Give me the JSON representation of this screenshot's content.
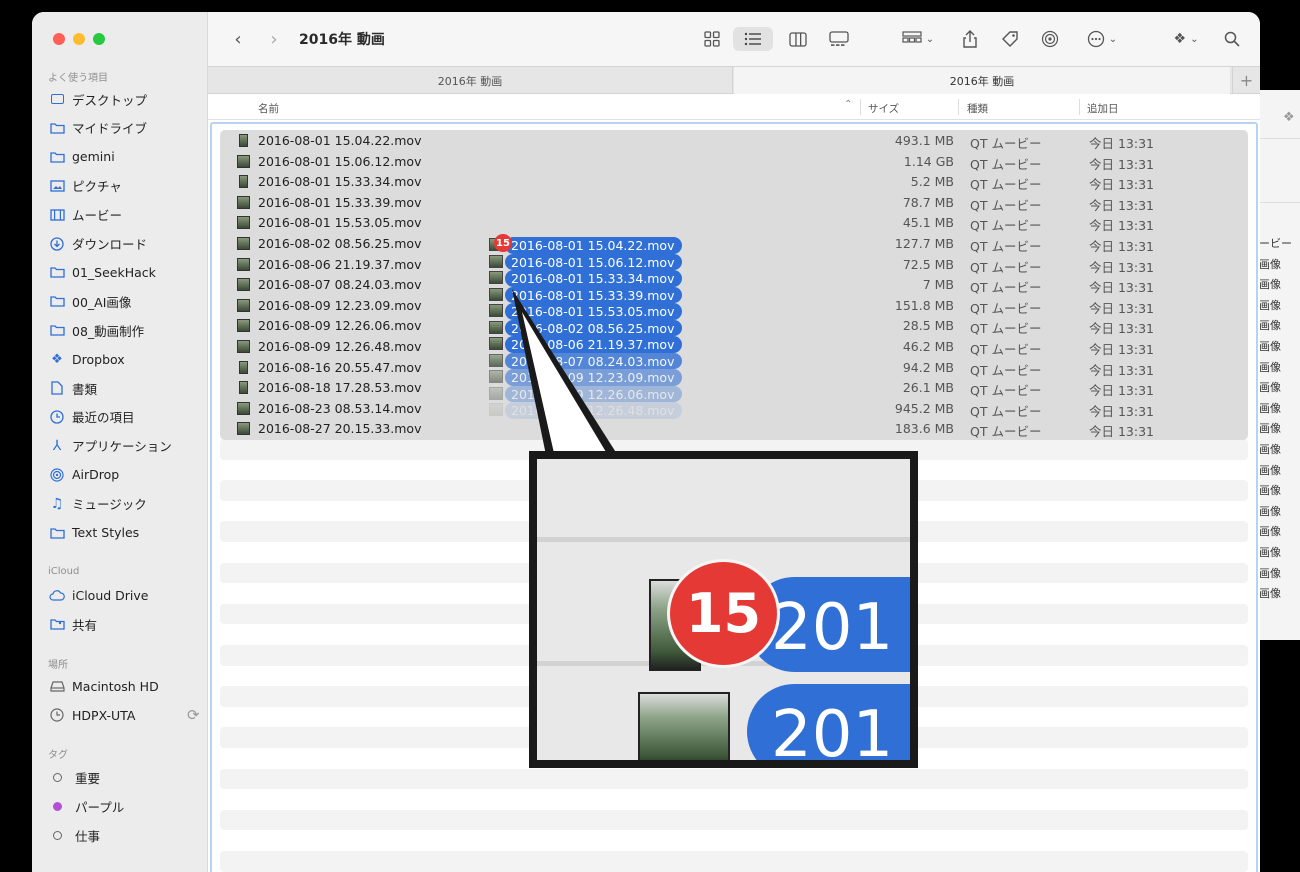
{
  "window": {
    "title": "2016年 動画"
  },
  "sidebar": {
    "favorites_header": "よく使う項目",
    "favorites": [
      {
        "label": "デスクトップ",
        "icon": "desktop-icon"
      },
      {
        "label": "マイドライブ",
        "icon": "folder-icon"
      },
      {
        "label": "gemini",
        "icon": "folder-icon"
      },
      {
        "label": "ピクチャ",
        "icon": "photo-icon"
      },
      {
        "label": "ムービー",
        "icon": "film-icon"
      },
      {
        "label": "ダウンロード",
        "icon": "download-icon"
      },
      {
        "label": "01_SeekHack",
        "icon": "folder-icon"
      },
      {
        "label": "00_AI画像",
        "icon": "folder-icon"
      },
      {
        "label": "08_動画制作",
        "icon": "folder-icon"
      },
      {
        "label": "Dropbox",
        "icon": "dropbox-icon"
      },
      {
        "label": "書類",
        "icon": "document-icon"
      },
      {
        "label": "最近の項目",
        "icon": "clock-icon"
      },
      {
        "label": "アプリケーション",
        "icon": "apps-icon"
      },
      {
        "label": "AirDrop",
        "icon": "airdrop-icon"
      },
      {
        "label": "ミュージック",
        "icon": "music-icon"
      },
      {
        "label": "Text Styles",
        "icon": "folder-icon"
      }
    ],
    "icloud_header": "iCloud",
    "icloud": [
      {
        "label": "iCloud Drive",
        "icon": "cloud-icon"
      },
      {
        "label": "共有",
        "icon": "shared-folder-icon"
      }
    ],
    "locations_header": "場所",
    "locations": [
      {
        "label": "Macintosh HD",
        "icon": "disk-icon"
      },
      {
        "label": "HDPX-UTA",
        "icon": "clock-disk-icon"
      }
    ],
    "tags_header": "タグ",
    "tags": [
      {
        "label": "重要",
        "color": "#ffffff"
      },
      {
        "label": "パープル",
        "color": "#b44fd8"
      },
      {
        "label": "仕事",
        "color": "#ffffff"
      }
    ]
  },
  "tabs": [
    {
      "label": "2016年 動画"
    },
    {
      "label": "2016年 動画"
    }
  ],
  "columns": {
    "name": "名前",
    "size": "サイズ",
    "kind": "種類",
    "added": "追加日"
  },
  "files": [
    {
      "name": "2016-08-01 15.04.22.mov",
      "size": "493.1 MB",
      "kind": "QT ムービー",
      "added": "今日 13:31",
      "portrait": true
    },
    {
      "name": "2016-08-01 15.06.12.mov",
      "size": "1.14 GB",
      "kind": "QT ムービー",
      "added": "今日 13:31",
      "portrait": false
    },
    {
      "name": "2016-08-01 15.33.34.mov",
      "size": "5.2 MB",
      "kind": "QT ムービー",
      "added": "今日 13:31",
      "portrait": true
    },
    {
      "name": "2016-08-01 15.33.39.mov",
      "size": "78.7 MB",
      "kind": "QT ムービー",
      "added": "今日 13:31",
      "portrait": false
    },
    {
      "name": "2016-08-01 15.53.05.mov",
      "size": "45.1 MB",
      "kind": "QT ムービー",
      "added": "今日 13:31",
      "portrait": false
    },
    {
      "name": "2016-08-02 08.56.25.mov",
      "size": "127.7 MB",
      "kind": "QT ムービー",
      "added": "今日 13:31",
      "portrait": false
    },
    {
      "name": "2016-08-06 21.19.37.mov",
      "size": "72.5 MB",
      "kind": "QT ムービー",
      "added": "今日 13:31",
      "portrait": false
    },
    {
      "name": "2016-08-07 08.24.03.mov",
      "size": "7 MB",
      "kind": "QT ムービー",
      "added": "今日 13:31",
      "portrait": false
    },
    {
      "name": "2016-08-09 12.23.09.mov",
      "size": "151.8 MB",
      "kind": "QT ムービー",
      "added": "今日 13:31",
      "portrait": false
    },
    {
      "name": "2016-08-09 12.26.06.mov",
      "size": "28.5 MB",
      "kind": "QT ムービー",
      "added": "今日 13:31",
      "portrait": false
    },
    {
      "name": "2016-08-09 12.26.48.mov",
      "size": "46.2 MB",
      "kind": "QT ムービー",
      "added": "今日 13:31",
      "portrait": false
    },
    {
      "name": "2016-08-16 20.55.47.mov",
      "size": "94.2 MB",
      "kind": "QT ムービー",
      "added": "今日 13:31",
      "portrait": true
    },
    {
      "name": "2016-08-18 17.28.53.mov",
      "size": "26.1 MB",
      "kind": "QT ムービー",
      "added": "今日 13:31",
      "portrait": true
    },
    {
      "name": "2016-08-23 08.53.14.mov",
      "size": "945.2 MB",
      "kind": "QT ムービー",
      "added": "今日 13:31",
      "portrait": false
    },
    {
      "name": "2016-08-27 20.15.33.mov",
      "size": "183.6 MB",
      "kind": "QT ムービー",
      "added": "今日 13:31",
      "portrait": false
    }
  ],
  "drag": {
    "count": "15",
    "items": [
      "2016-08-01 15.04.22.mov",
      "2016-08-01 15.06.12.mov",
      "2016-08-01 15.33.34.mov",
      "2016-08-01 15.33.39.mov",
      "2016-08-01 15.53.05.mov",
      "2016-08-02 08.56.25.mov",
      "2016-08-06 21.19.37.mov",
      "2016-08-07 08.24.03.mov",
      "2016-08-09 12.23.09.mov",
      "2016-08-09 12.26.06.mov",
      "2016-08-09 12.26.48.mov"
    ]
  },
  "zoom": {
    "badge": "15",
    "pill_text_1": "201",
    "pill_text_2": "201"
  },
  "background_window": {
    "kinds": [
      "ービー",
      "画像",
      "画像",
      "画像",
      "画像",
      "画像",
      "画像",
      "画像",
      "画像",
      "画像",
      "画像",
      "画像",
      "画像",
      "画像",
      "画像",
      "画像",
      "画像",
      "画像"
    ]
  },
  "colors": {
    "accent": "#2f6fd6",
    "badge": "#e53935"
  }
}
